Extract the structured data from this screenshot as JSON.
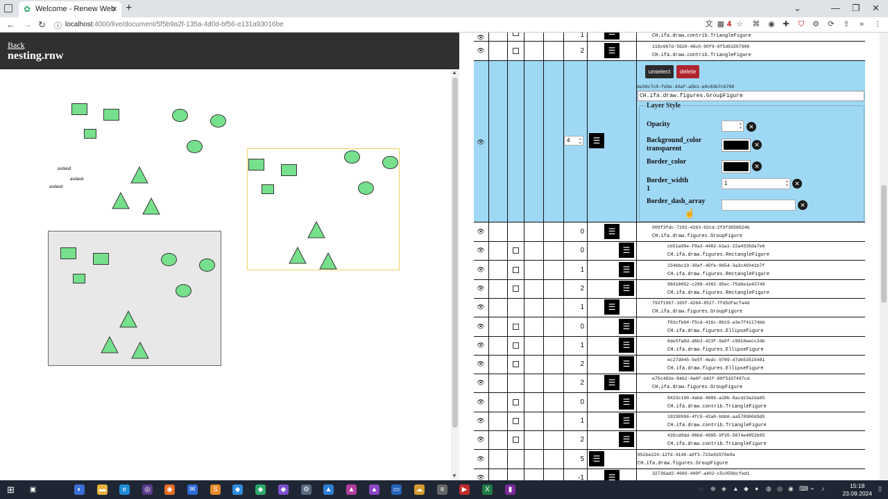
{
  "browser": {
    "tab_title": "Welcome - Renew Web",
    "url_host": "localhost",
    "url_rest": ":4000/live/document/5f5b9a2f-135a-4d0d-bf56-e131a93016be",
    "ext_badge": "4"
  },
  "header": {
    "back_label": "Back",
    "doc_title": "nesting.rnw"
  },
  "canvas": {
    "labels": [
      "asdasd",
      "asdasd",
      "asdasd"
    ],
    "fill_color": "#77e08d",
    "group_bg": "#e8e8e8",
    "selection_color": "#f0d060"
  },
  "selected": {
    "depth_value": "4",
    "unselect_label": "unselect",
    "delete_label": "delete",
    "uuid": "de30c7c9-fd3e-43af-a5b1-e0c83b7c6790",
    "class": "CH.ifa.draw.figures.GroupFigure",
    "layer_style_legend": "Layer Style",
    "opacity_label": "Opacity",
    "bg_color_label": "Background_color",
    "bg_color_sub": "transparent",
    "border_color_label": "Border_color",
    "border_width_label": "Border_width",
    "border_width_sub": "1",
    "border_width_value": "1",
    "dash_label": "Border_dash_array",
    "highlight_color": "#9fd8f5"
  },
  "rows_top": [
    {
      "num": "1",
      "uuid": "",
      "class": "CH.ifa.draw.contrib.TriangleFigure"
    },
    {
      "num": "2",
      "uuid": "219c667d-5620-48c0-90f9-0f5d61507906",
      "class": "CH.ifa.draw.contrib.TriangleFigure"
    }
  ],
  "rows": [
    {
      "num": "0",
      "uuid": "009f3fdc-7193-42b3-92cd-2f3f3658624b",
      "class": "CH.ifa.draw.figures.GroupFigure",
      "check": false,
      "indent": 1
    },
    {
      "num": "0",
      "uuid": "cb51a99e-f8a3-4482-b1a1-22a4335da7e6",
      "class": "CH.ifa.draw.figures.RectangleFigure",
      "check": true,
      "indent": 2
    },
    {
      "num": "1",
      "uuid": "234bbc19-30af-45fe-9654-3a3c49341b7f",
      "class": "CH.ifa.draw.figures.RectangleFigure",
      "check": true,
      "indent": 2
    },
    {
      "num": "2",
      "uuid": "88410052-c288-4382-95ec-75d6e1e43749",
      "class": "CH.ifa.draw.figures.RectangleFigure",
      "check": true,
      "indent": 2
    },
    {
      "num": "1",
      "uuid": "792f1967-165f-4264-8527-7fd5dfacfa4d",
      "class": "CH.ifa.draw.figures.GroupFigure",
      "check": false,
      "indent": 1
    },
    {
      "num": "0",
      "uuid": "f03cfb04-f5cd-416c-8619-a3e7f41174bb",
      "class": "CH.ifa.draw.figures.EllipseFigure",
      "check": true,
      "indent": 2
    },
    {
      "num": "1",
      "uuid": "6de5fa8d-d6b3-423f-9a9f-c9918eecc34b",
      "class": "CH.ifa.draw.figures.EllipseFigure",
      "check": true,
      "indent": 2
    },
    {
      "num": "2",
      "uuid": "ec27d045-5e5f-4edc-9789-d7db53515481",
      "class": "CH.ifa.draw.figures.EllipseFigure",
      "check": true,
      "indent": 2
    },
    {
      "num": "2",
      "uuid": "e75c492e-8462-4a0f-b42f-89f5107487cd",
      "class": "CH.ifa.draw.figures.GroupFigure",
      "check": false,
      "indent": 1
    },
    {
      "num": "0",
      "uuid": "8423c190-4abd-4086-a18b-8acd23a2da05",
      "class": "CH.ifa.draw.contrib.TriangleFigure",
      "check": true,
      "indent": 2
    },
    {
      "num": "1",
      "uuid": "19290996-4fc5-42a0-bbb6-aa578960d9d5",
      "class": "CH.ifa.draw.contrib.TriangleFigure",
      "check": true,
      "indent": 2
    },
    {
      "num": "2",
      "uuid": "435cd0dd-86bd-4995-9f35-5874e4852b95",
      "class": "CH.ifa.draw.contrib.TriangleFigure",
      "check": true,
      "indent": 2
    },
    {
      "num": "5",
      "uuid": "852be224-12fd-4148-a0f3-723e02970e0a",
      "class": "CH.ifa.draw.figures.GroupFigure",
      "check": false,
      "indent": 0
    },
    {
      "num": "-1",
      "uuid": "32736ad2-4669-490f-a402-c5c056bcfed1",
      "class": "",
      "check": false,
      "indent": 1
    }
  ],
  "taskbar": {
    "time": "15:18",
    "date": "23.09.2024"
  }
}
